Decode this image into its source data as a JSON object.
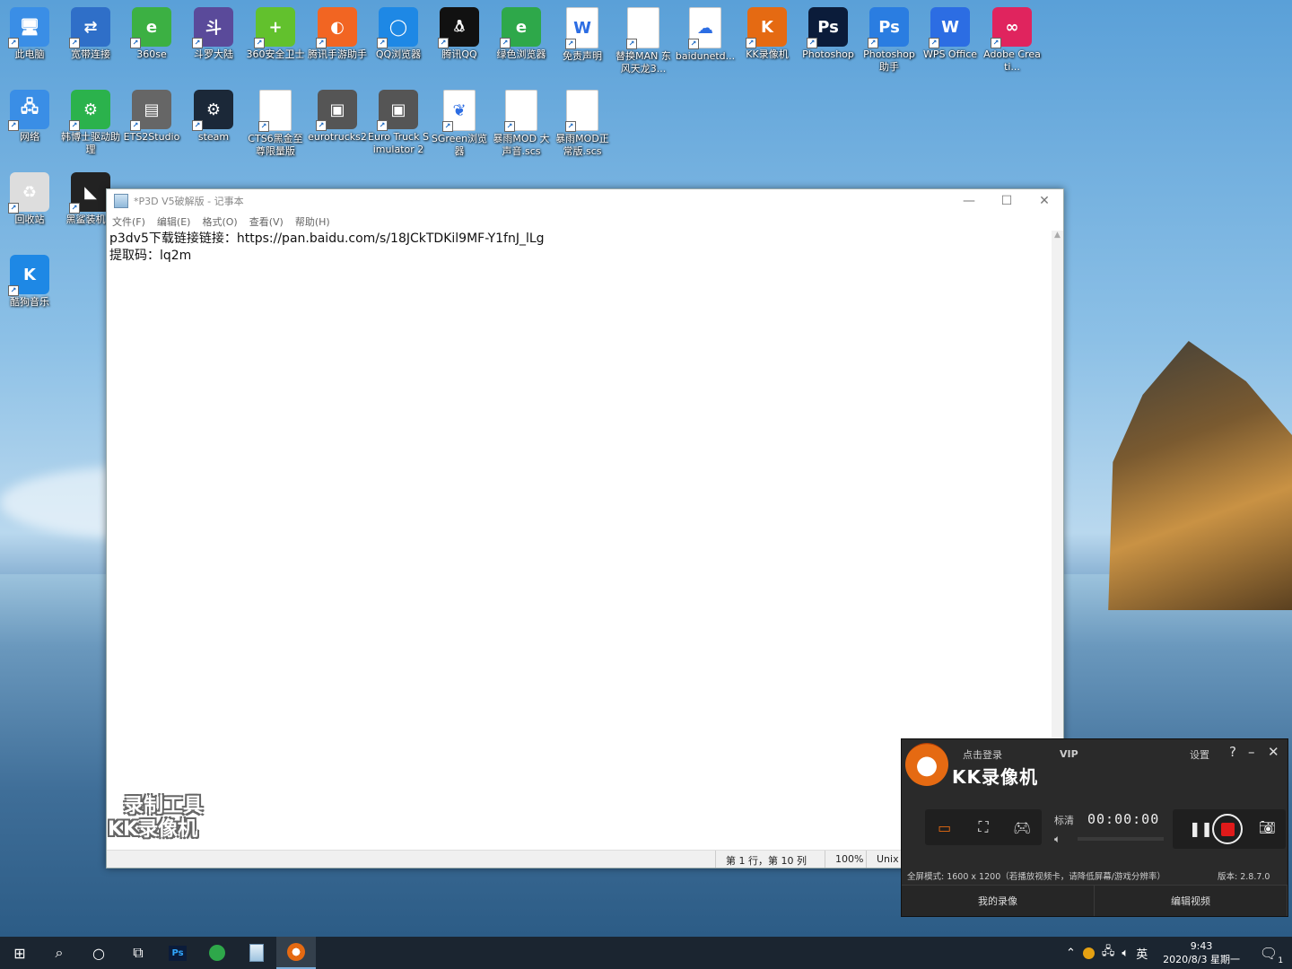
{
  "desktop": {
    "icons": [
      {
        "label": "此电脑",
        "icon": "computer-icon",
        "color": "#3a8ee6"
      },
      {
        "label": "宽带连接",
        "icon": "network-connection-icon",
        "color": "#2f6fc8"
      },
      {
        "label": "360se",
        "icon": "360se-browser-icon",
        "color": "#3cb043"
      },
      {
        "label": "斗罗大陆",
        "icon": "game-douluo-icon",
        "color": "#5a4a9a"
      },
      {
        "label": "360安全卫士",
        "icon": "360-security-icon",
        "color": "#62c12d"
      },
      {
        "label": "腾讯手游助手",
        "icon": "tencent-mobile-game-icon",
        "color": "#f26522"
      },
      {
        "label": "QQ浏览器",
        "icon": "qq-browser-icon",
        "color": "#1e88e5"
      },
      {
        "label": "腾讯QQ",
        "icon": "qq-penguin-icon",
        "color": "#111111"
      },
      {
        "label": "绿色浏览器",
        "icon": "green-browser-icon",
        "color": "#2ea84a"
      },
      {
        "label": "免责声明",
        "icon": "word-document-icon",
        "color": "#ffffff"
      },
      {
        "label": "替换MAN 东风天龙3...",
        "icon": "file-icon",
        "color": "#ffffff"
      },
      {
        "label": "baidunetd...",
        "icon": "baidu-netdisk-icon",
        "color": "#ffffff"
      },
      {
        "label": "KK录像机",
        "icon": "kk-recorder-icon",
        "color": "#e56a12"
      },
      {
        "label": "Photoshop",
        "icon": "photoshop-icon",
        "color": "#0b1c3a"
      },
      {
        "label": "Photoshop 助手",
        "icon": "photoshop-helper-icon",
        "color": "#2a7de1"
      },
      {
        "label": "WPS Office",
        "icon": "wps-office-icon",
        "color": "#2c6de3"
      },
      {
        "label": "Adobe Creati...",
        "icon": "adobe-creative-cloud-icon",
        "color": "#e0245e"
      },
      {
        "label": "网络",
        "icon": "network-globe-icon",
        "color": "#3a8ee6"
      },
      {
        "label": "韩博士驱动助理",
        "icon": "driver-helper-icon",
        "color": "#2bb24c"
      },
      {
        "label": "ETS2Studio",
        "icon": "ets2studio-icon",
        "color": "#666666"
      },
      {
        "label": "steam",
        "icon": "steam-icon",
        "color": "#1b2838"
      },
      {
        "label": "CTS6黑金至尊限量版",
        "icon": "file-icon",
        "color": "#ffffff"
      },
      {
        "label": "eurotrucks2",
        "icon": "truck-icon",
        "color": "#555555"
      },
      {
        "label": "Euro Truck Simulator 2",
        "icon": "truck-icon",
        "color": "#555555"
      },
      {
        "label": "SGreen浏览器",
        "icon": "sgreen-browser-icon",
        "color": "#ffffff"
      },
      {
        "label": "暴雨MOD 大声音.scs",
        "icon": "file-icon",
        "color": "#ffffff"
      },
      {
        "label": "暴雨MOD正常版.scs",
        "icon": "file-icon",
        "color": "#ffffff"
      },
      {
        "label": "回收站",
        "icon": "recycle-bin-icon",
        "color": "#dddddd"
      },
      {
        "label": "黑鲨装机大",
        "icon": "blackshark-icon",
        "color": "#222222"
      },
      {
        "label": "酷狗音乐",
        "icon": "kugou-music-icon",
        "color": "#1e88e5"
      }
    ]
  },
  "notepad": {
    "title": "*P3D V5破解版 - 记事本",
    "menu": [
      "文件(F)",
      "编辑(E)",
      "格式(O)",
      "查看(V)",
      "帮助(H)"
    ],
    "lines": [
      "p3dv5下载链接链接：https://pan.baidu.com/s/18JCkTDKil9MF-Y1fnJ_lLg",
      "提取码：lq2m"
    ],
    "status": {
      "position": "第 1 行，第 10 列",
      "zoom": "100%",
      "eol": "Unix"
    }
  },
  "watermark": {
    "line1": "录制工具",
    "line2": "KK录像机"
  },
  "kk_recorder": {
    "login": "点击登录",
    "vip": "VIP",
    "name": "KK录像机",
    "settings": "设置",
    "help": "?",
    "minimize": "–",
    "close": "✕",
    "quality": "标清",
    "timer": "00:00:00",
    "info": "全屏模式: 1600 x 1200（若播放视频卡，请降低屏幕/游戏分辨率）",
    "version": "版本: 2.8.7.0",
    "my_recordings": "我的录像",
    "edit_video": "编辑视频",
    "record_color": "#e01a1a"
  },
  "taskbar": {
    "ime": "英",
    "time": "9:43",
    "date": "2020/8/3 星期一",
    "notification_count": "1"
  }
}
